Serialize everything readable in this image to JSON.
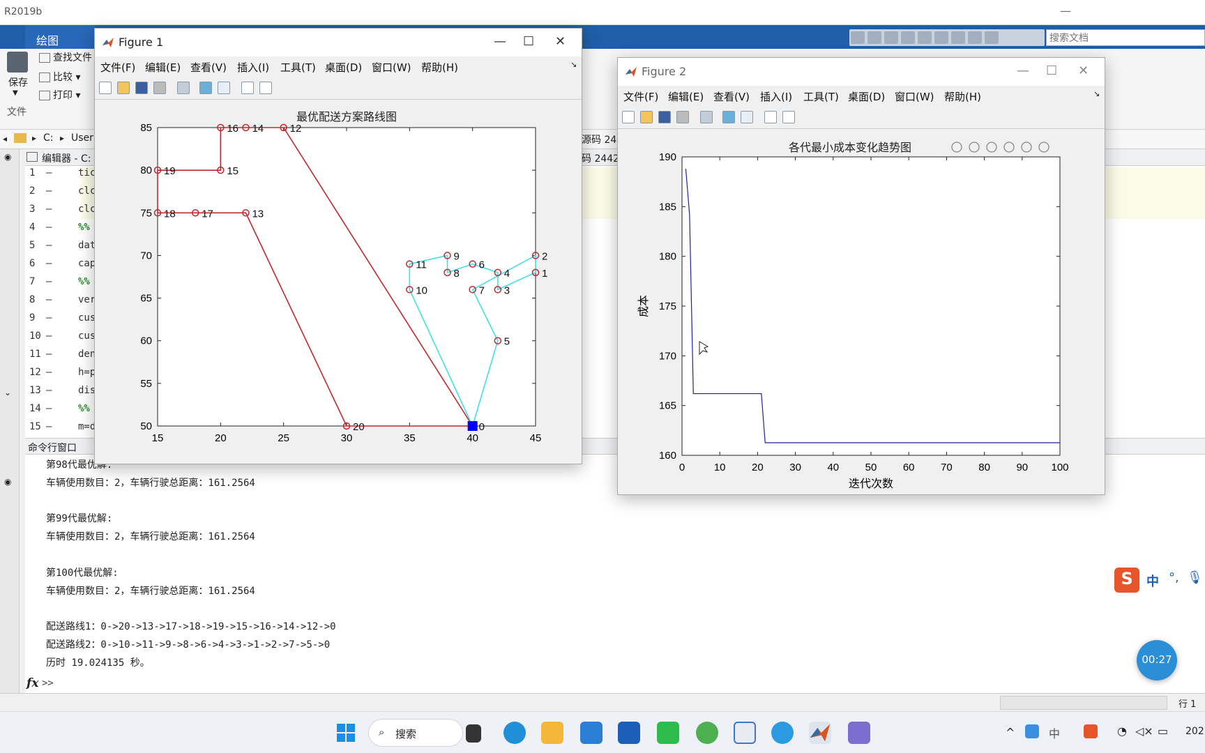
{
  "main": {
    "title": "R2019b",
    "tab_label": "绘图",
    "search_docs_placeholder": "搜索文档",
    "ribbon": {
      "save_label": "保存",
      "find_files_label": "查找文件",
      "compare_label": "比较",
      "print_label": "打印",
      "file_group_label": "文件"
    },
    "address": {
      "path_drive": "C:",
      "path_user": "User"
    },
    "editor_title": "编辑器 - C:",
    "editor_partial_right": "源码 24",
    "editor_partial_right2": "码 2442",
    "editor_lines": [
      {
        "n": "1",
        "code": "tic"
      },
      {
        "n": "2",
        "code": "clc"
      },
      {
        "n": "3",
        "code": "clc"
      },
      {
        "n": "4",
        "code": "%%"
      },
      {
        "n": "5",
        "code": "dat"
      },
      {
        "n": "6",
        "code": "cap"
      },
      {
        "n": "7",
        "code": "%%"
      },
      {
        "n": "8",
        "code": "ver"
      },
      {
        "n": "9",
        "code": "cus"
      },
      {
        "n": "10",
        "code": "cus"
      },
      {
        "n": "11",
        "code": "den"
      },
      {
        "n": "12",
        "code": "h=p"
      },
      {
        "n": "13",
        "code": "dis"
      },
      {
        "n": "14",
        "code": "%%"
      },
      {
        "n": "15",
        "code": "m=d"
      }
    ],
    "cmd_title": "命令行窗口",
    "cmd_lines": [
      "第98代最优解:",
      "车辆使用数目：2，车辆行驶总距离：161.2564",
      "",
      "第99代最优解:",
      "车辆使用数目：2，车辆行驶总距离：161.2564",
      "",
      "第100代最优解:",
      "车辆使用数目：2，车辆行驶总距离：161.2564",
      "",
      "配送路线1：0->20->13->17->18->19->15->16->14->12->0",
      "配送路线2：0->10->11->9->8->6->4->3->1->2->7->5->0",
      "历时 19.024135 秒。"
    ],
    "prompt": ">>",
    "fx": "fx",
    "status_right": "行 1"
  },
  "menus": [
    "文件(F)",
    "编辑(E)",
    "查看(V)",
    "插入(I)",
    "工具(T)",
    "桌面(D)",
    "窗口(W)",
    "帮助(H)"
  ],
  "figure1": {
    "title": "Figure 1",
    "chart_data": {
      "type": "scatter",
      "title": "最优配送方案路线图",
      "xlim": [
        15,
        45
      ],
      "ylim": [
        50,
        85
      ],
      "xticks": [
        15,
        20,
        25,
        30,
        35,
        40,
        45
      ],
      "yticks": [
        50,
        55,
        60,
        65,
        70,
        75,
        80,
        85
      ],
      "grid": false,
      "depot": {
        "id": "0",
        "x": 40,
        "y": 50
      },
      "nodes": [
        {
          "id": "1",
          "x": 45,
          "y": 68
        },
        {
          "id": "2",
          "x": 45,
          "y": 70
        },
        {
          "id": "3",
          "x": 42,
          "y": 66
        },
        {
          "id": "4",
          "x": 42,
          "y": 68
        },
        {
          "id": "5",
          "x": 42,
          "y": 60
        },
        {
          "id": "6",
          "x": 40,
          "y": 69
        },
        {
          "id": "7",
          "x": 40,
          "y": 66
        },
        {
          "id": "8",
          "x": 38,
          "y": 68
        },
        {
          "id": "9",
          "x": 38,
          "y": 70
        },
        {
          "id": "10",
          "x": 35,
          "y": 66
        },
        {
          "id": "11",
          "x": 35,
          "y": 69
        },
        {
          "id": "12",
          "x": 25,
          "y": 85
        },
        {
          "id": "13",
          "x": 22,
          "y": 75
        },
        {
          "id": "14",
          "x": 22,
          "y": 85
        },
        {
          "id": "15",
          "x": 20,
          "y": 80
        },
        {
          "id": "16",
          "x": 20,
          "y": 85
        },
        {
          "id": "17",
          "x": 18,
          "y": 75
        },
        {
          "id": "18",
          "x": 15,
          "y": 75
        },
        {
          "id": "19",
          "x": 15,
          "y": 80
        },
        {
          "id": "20",
          "x": 30,
          "y": 50
        }
      ],
      "series": [
        {
          "color": "#c0282e",
          "route": [
            "0",
            "20",
            "13",
            "17",
            "18",
            "19",
            "15",
            "16",
            "14",
            "12",
            "0"
          ]
        },
        {
          "color": "#3fe0e8",
          "route": [
            "0",
            "10",
            "11",
            "9",
            "8",
            "6",
            "4",
            "3",
            "1",
            "2",
            "7",
            "5",
            "0"
          ]
        }
      ]
    }
  },
  "figure2": {
    "title": "Figure 2",
    "chart_data": {
      "type": "line",
      "title": "各代最小成本变化趋势图",
      "xlabel": "迭代次数",
      "ylabel": "成本",
      "xlim": [
        0,
        100
      ],
      "ylim": [
        160,
        190
      ],
      "xticks": [
        0,
        10,
        20,
        30,
        40,
        50,
        60,
        70,
        80,
        90,
        100
      ],
      "yticks": [
        160,
        165,
        170,
        175,
        180,
        185,
        190
      ],
      "grid": false,
      "color": "#1f1fa0",
      "x": [
        1,
        2,
        3,
        4,
        5,
        10,
        15,
        20,
        21,
        22,
        30,
        40,
        50,
        60,
        70,
        80,
        90,
        100
      ],
      "y": [
        188.8,
        184.2,
        166.2,
        166.2,
        166.2,
        166.2,
        166.2,
        166.2,
        166.2,
        161.26,
        161.26,
        161.26,
        161.26,
        161.26,
        161.26,
        161.26,
        161.26,
        161.26
      ]
    }
  },
  "taskbar": {
    "search_label": "搜索",
    "ime_label": "中",
    "timer": "00:27",
    "clock_partial": "202"
  }
}
